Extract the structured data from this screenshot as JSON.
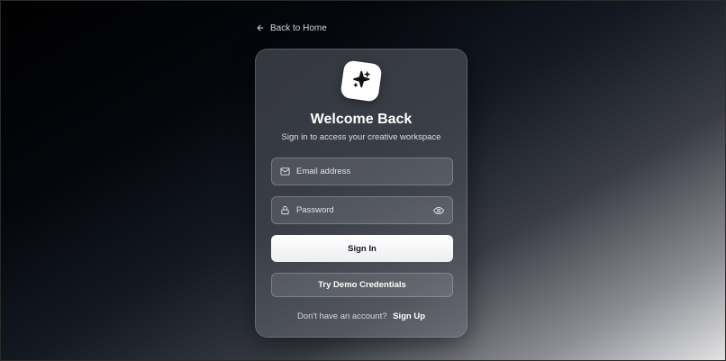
{
  "back_link": {
    "label": "Back to Home",
    "icon": "arrow-left-icon"
  },
  "card": {
    "logo_icon": "sparkle-icon",
    "title": "Welcome Back",
    "subtitle": "Sign in to access your creative workspace"
  },
  "form": {
    "email": {
      "placeholder": "Email address",
      "value": "",
      "icon": "mail-icon"
    },
    "password": {
      "placeholder": "Password",
      "value": "",
      "icon": "lock-icon",
      "toggle_icon": "eye-icon"
    },
    "sign_in_label": "Sign In",
    "demo_label": "Try Demo Credentials"
  },
  "footer": {
    "question": "Don't have an account?",
    "sign_up_label": "Sign Up"
  },
  "colors": {
    "card_text": "#ffffff",
    "primary_button_bg": "#ffffff",
    "primary_button_text": "#16181d"
  }
}
